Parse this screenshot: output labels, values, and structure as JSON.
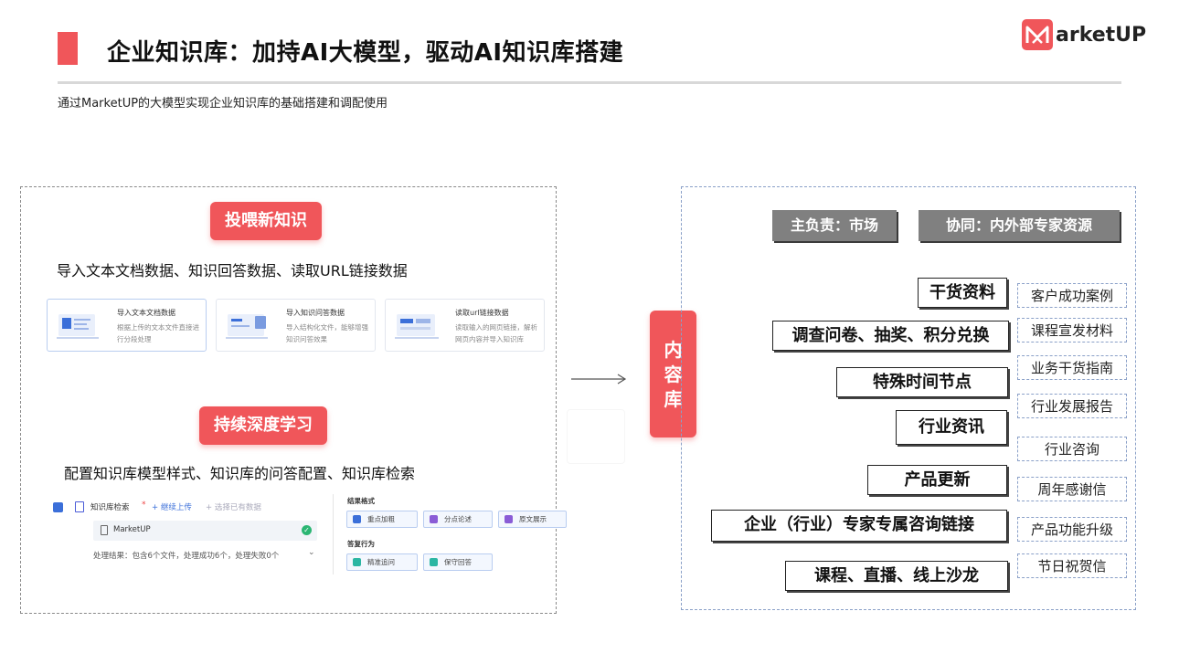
{
  "header": {
    "title": "企业知识库：加持AI大模型，驱动AI知识库搭建",
    "subtitle": "通过MarketUP的大模型实现企业知识库的基础搭建和调配使用",
    "logo_text": "arketUP",
    "accent": "#f0565a"
  },
  "left": {
    "feed_label": "投喂新知识",
    "feed_desc": "导入文本文档数据、知识回答数据、读取URL链接数据",
    "cards": [
      {
        "title": "导入文本文档数据",
        "desc": "根据上传的文本文件直接进行分段处理"
      },
      {
        "title": "导入知识问答数据",
        "desc": "导入结构化文件，能够增强知识问答效果"
      },
      {
        "title": "读取url链接数据",
        "desc": "读取输入的网页链接，解析网页内容并导入知识库"
      }
    ],
    "learn_label": "持续深度学习",
    "learn_desc": "配置知识库模型样式、知识库的问答配置、知识库检索",
    "mock": {
      "kb_search": "知识库检索",
      "star": "*",
      "continue_upload": "+ 继续上传",
      "select_existing": "+ 选择已有数据",
      "file_name": "MarketUP",
      "result": "处理结果：包含6个文件，处理成功6个，处理失败0个",
      "result_format": "结果格式",
      "format_opts": [
        "重点加粗",
        "分点论述",
        "原文展示"
      ],
      "answer_behavior": "答复行为",
      "behavior_opts": [
        "精准追问",
        "保守回答"
      ]
    }
  },
  "library_label": [
    "内",
    "容",
    "库"
  ],
  "right": {
    "owner": "主负责：市场",
    "collab": "协同：内外部专家资源",
    "boxes": [
      "干货资料",
      "调查问卷、抽奖、积分兑换",
      "特殊时间节点",
      "行业资讯",
      "产品更新",
      "企业（行业）专家专属咨询链接",
      "课程、直播、线上沙龙"
    ],
    "tags": [
      "客户成功案例",
      "课程宣发材料",
      "业务干货指南",
      "行业发展报告",
      "行业咨询",
      "周年感谢信",
      "产品功能升级",
      "节日祝贺信"
    ]
  }
}
